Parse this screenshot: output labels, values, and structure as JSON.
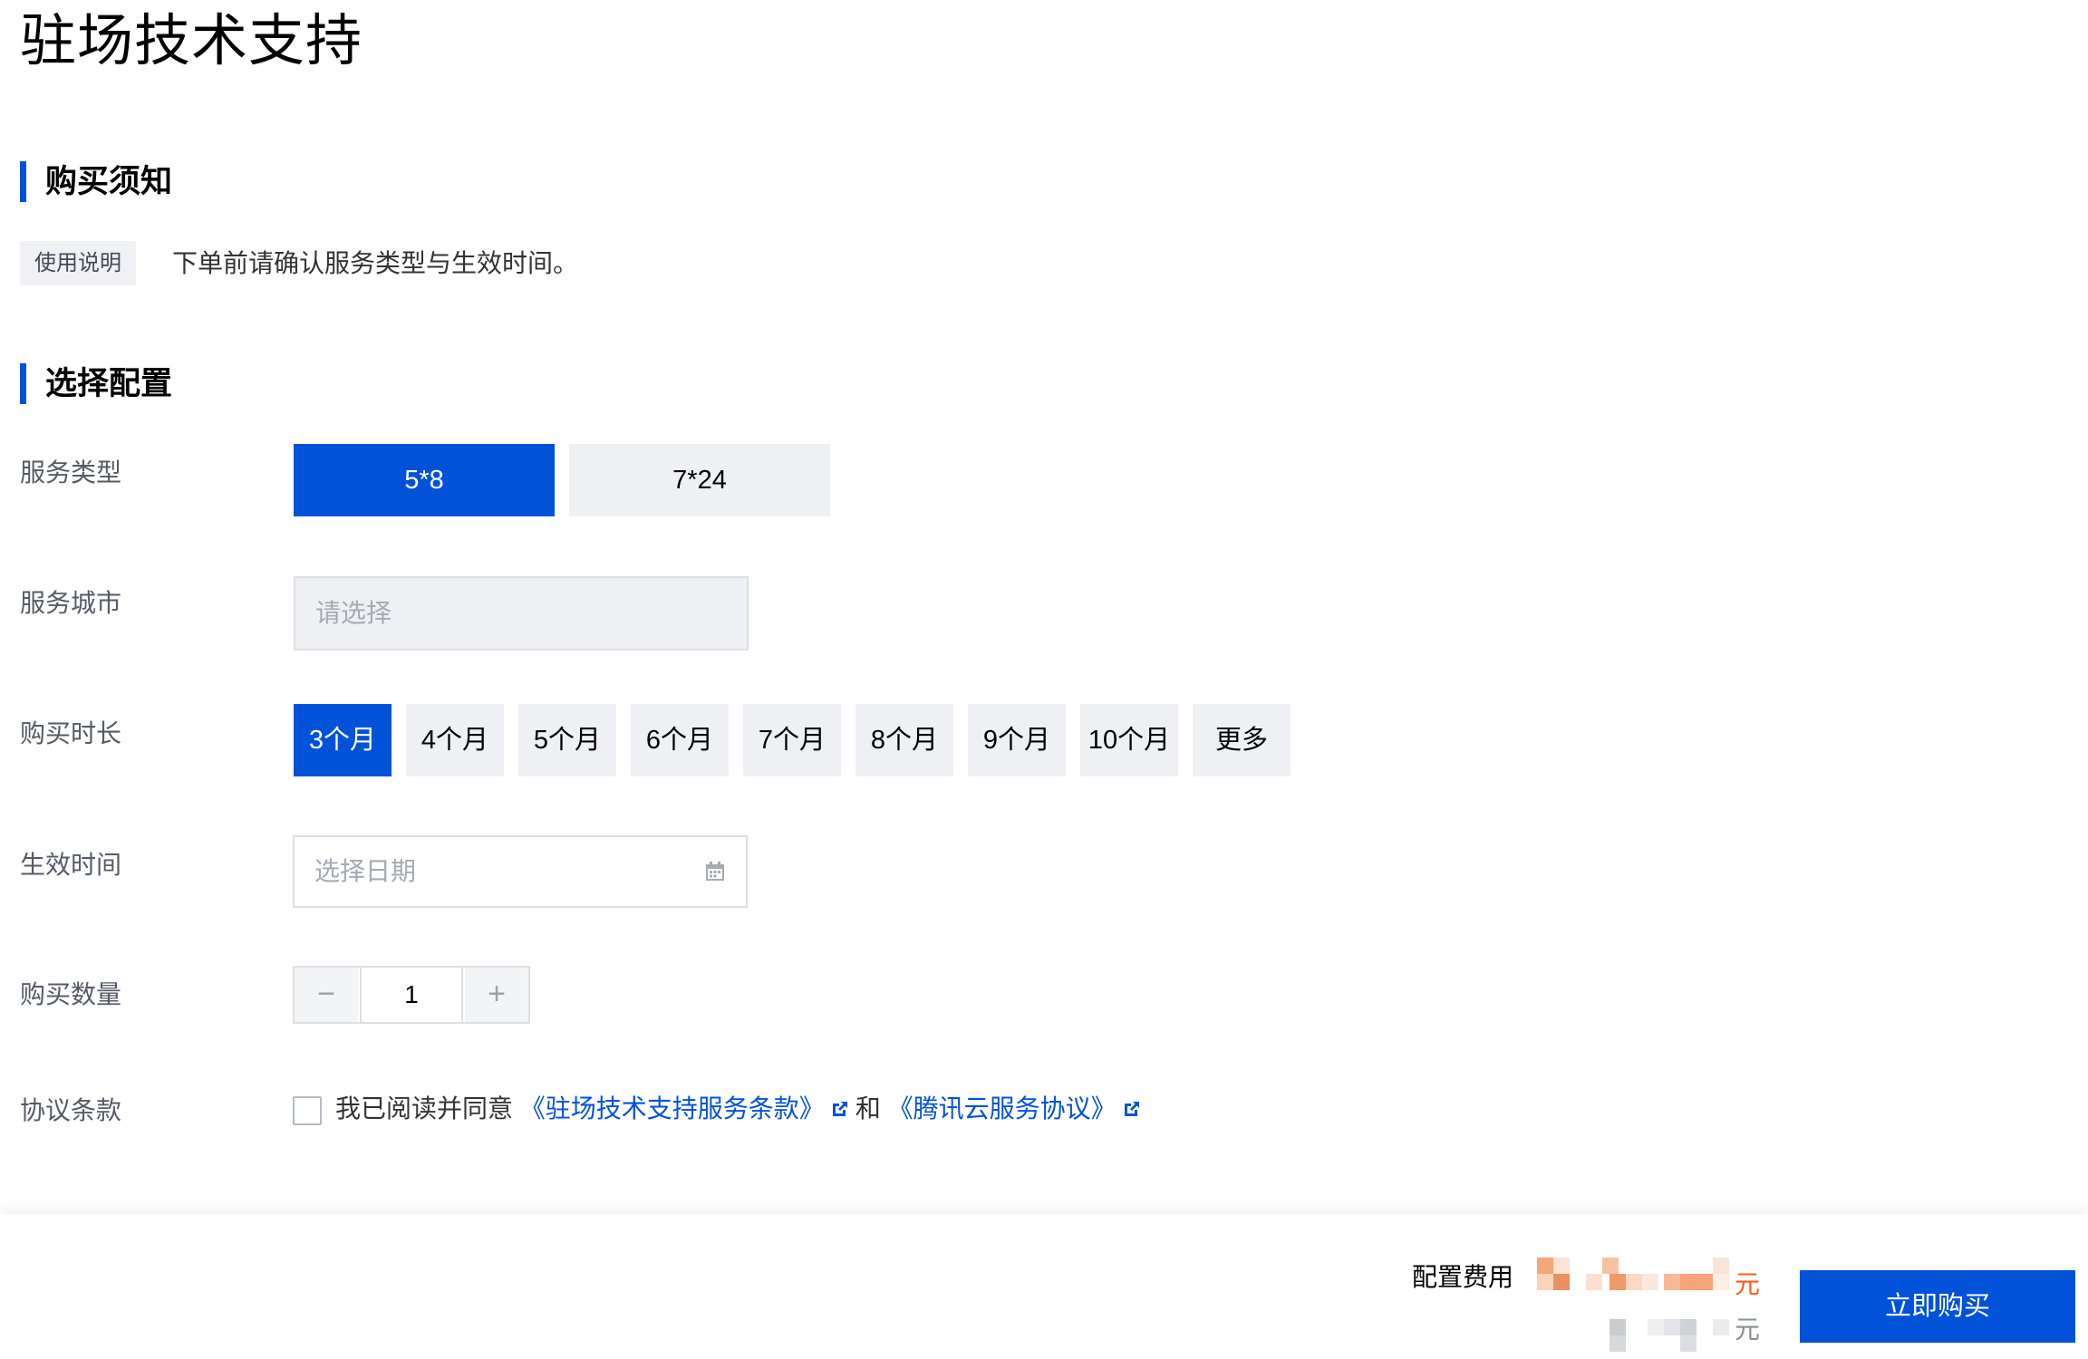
{
  "page": {
    "title": "驻场技术支持"
  },
  "notice_section": {
    "title": "购买须知",
    "tag": "使用说明",
    "text": "下单前请确认服务类型与生效时间。"
  },
  "config_section": {
    "title": "选择配置",
    "service_type": {
      "label": "服务类型",
      "options": [
        "5*8",
        "7*24"
      ],
      "selected": "5*8"
    },
    "service_city": {
      "label": "服务城市",
      "placeholder": "请选择"
    },
    "duration": {
      "label": "购买时长",
      "options": [
        "3个月",
        "4个月",
        "5个月",
        "6个月",
        "7个月",
        "8个月",
        "9个月",
        "10个月",
        "更多"
      ],
      "selected": "3个月"
    },
    "effective_time": {
      "label": "生效时间",
      "placeholder": "选择日期",
      "icon": "calendar-icon"
    },
    "quantity": {
      "label": "购买数量",
      "value": "1",
      "minus": "−",
      "plus": "+"
    },
    "agreement": {
      "label": "协议条款",
      "prefix": "我已阅读并同意",
      "link1": "《驻场技术支持服务条款》",
      "joiner": "和",
      "link2": "《腾讯云服务协议》",
      "checked": false
    }
  },
  "footer": {
    "fee_label": "配置费用",
    "currency1": "元",
    "currency2": "元",
    "buy_button": "立即购买"
  },
  "colors": {
    "primary": "#0052d9",
    "price": "#ff5c1a"
  }
}
